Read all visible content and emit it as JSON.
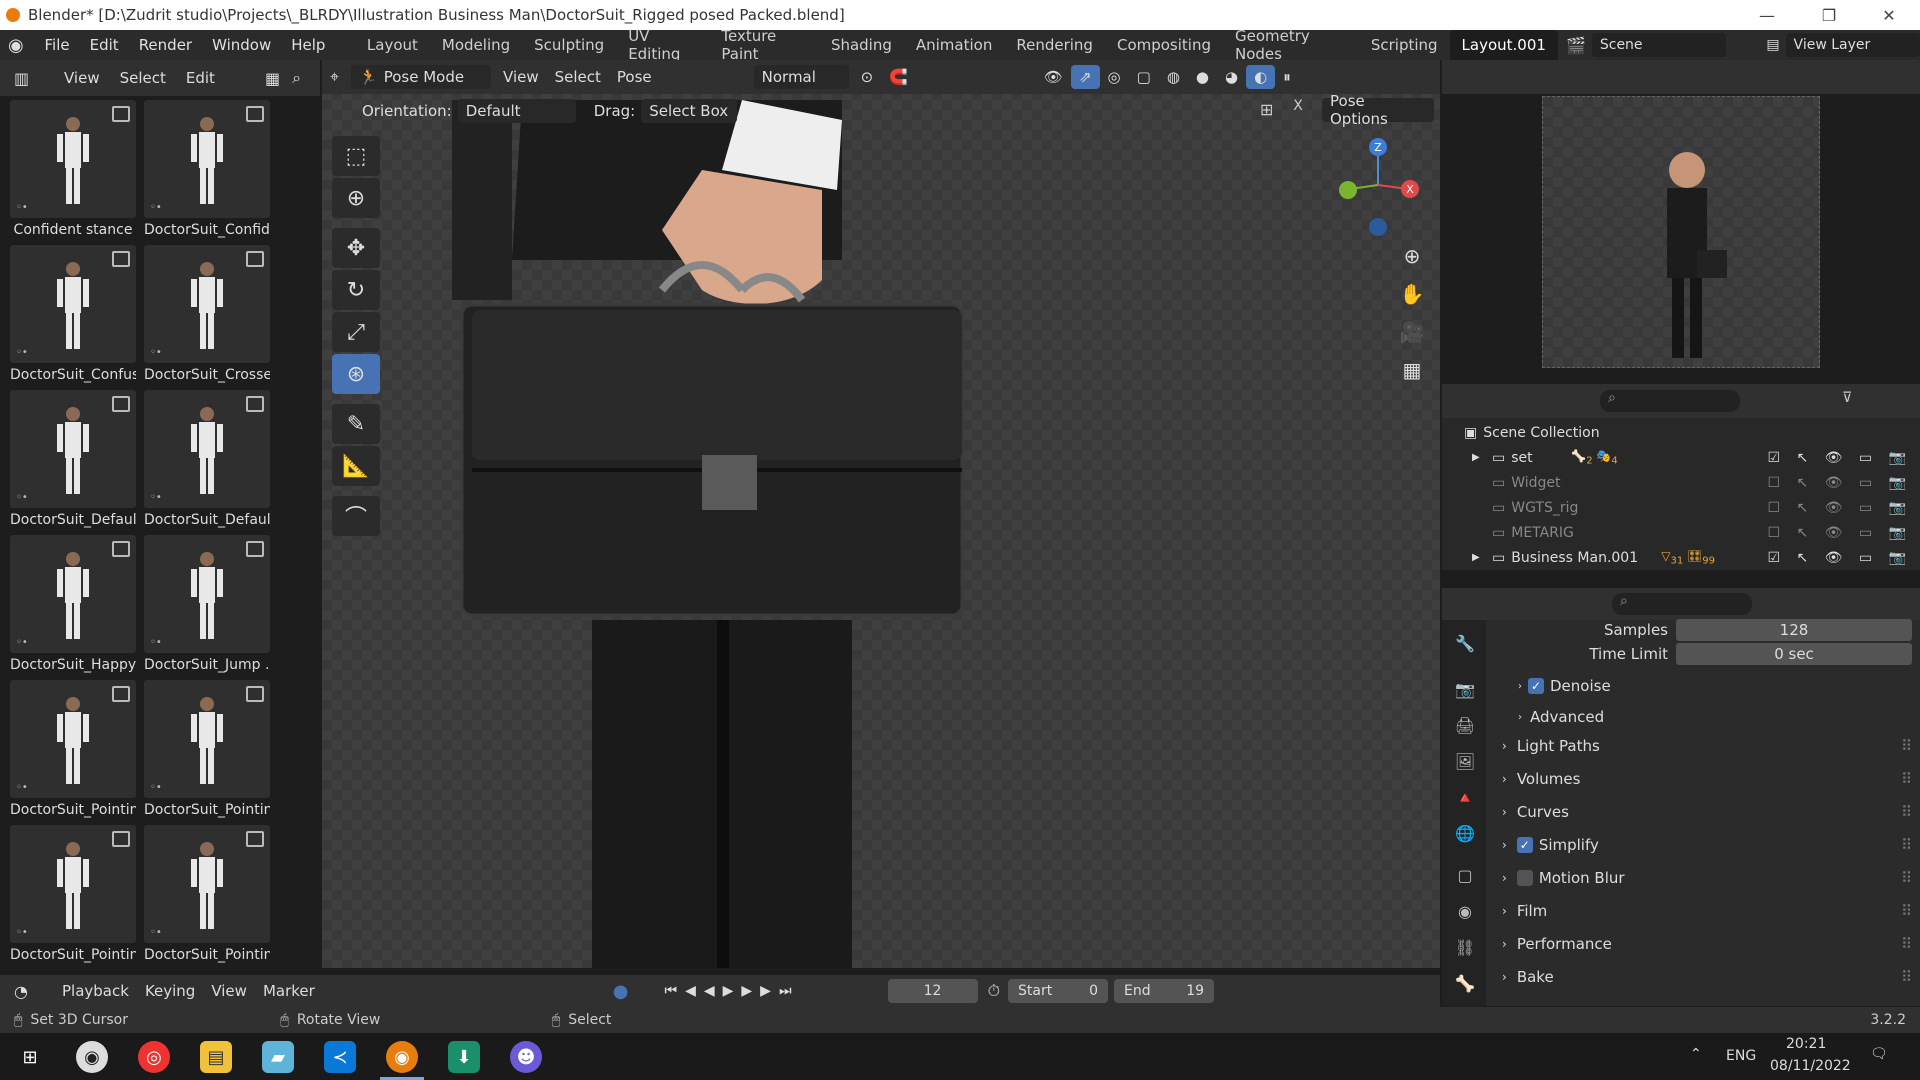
{
  "titlebar": {
    "title": "Blender* [D:\\Zudrit studio\\Projects\\_BLRDY\\Illustration Business Man\\DoctorSuit_Rigged posed Packed.blend]",
    "minimize": "—",
    "maximize": "❐",
    "close": "✕"
  },
  "menu": {
    "items": [
      "File",
      "Edit",
      "Render",
      "Window",
      "Help"
    ]
  },
  "workspaces": [
    "Layout",
    "Modeling",
    "Sculpting",
    "UV Editing",
    "Texture Paint",
    "Shading",
    "Animation",
    "Rendering",
    "Compositing",
    "Geometry Nodes",
    "Scripting",
    "Layout.001"
  ],
  "scene": {
    "label": "Scene",
    "view_layer": "View Layer"
  },
  "asset_panel": {
    "header": [
      "View",
      "Select",
      "Edit"
    ],
    "items": [
      {
        "label": "Confident stance"
      },
      {
        "label": "DoctorSuit_Confid..."
      },
      {
        "label": "DoctorSuit_Confus..."
      },
      {
        "label": "DoctorSuit_Crosse..."
      },
      {
        "label": "DoctorSuit_Defaul..."
      },
      {
        "label": "DoctorSuit_Defaul..."
      },
      {
        "label": "DoctorSuit_Happy"
      },
      {
        "label": "DoctorSuit_Jump ..."
      },
      {
        "label": "DoctorSuit_Pointin..."
      },
      {
        "label": "DoctorSuit_Pointin..."
      },
      {
        "label": "DoctorSuit_Pointin..."
      },
      {
        "label": "DoctorSuit_Pointin..."
      }
    ]
  },
  "viewport": {
    "mode": "Pose Mode",
    "header_menus": [
      "View",
      "Select",
      "Pose"
    ],
    "transform": "Normal",
    "orientation_label": "Orientation:",
    "orientation_value": "Default",
    "drag_label": "Drag:",
    "drag_value": "Select Box",
    "pose_options": "Pose Options",
    "gizmo": {
      "x": "X",
      "y": "Y",
      "z": "Z"
    }
  },
  "timeline": {
    "menus": [
      "Playback",
      "Keying",
      "View",
      "Marker"
    ],
    "current_frame": "12",
    "start_label": "Start",
    "start": "0",
    "end_label": "End",
    "end": "19"
  },
  "statusbar": {
    "left": "Set 3D Cursor",
    "middle": "Rotate View",
    "right": "Select",
    "version": "3.2.2"
  },
  "outliner": {
    "root": "Scene Collection",
    "rows": [
      {
        "name": "set",
        "count1": "2",
        "count2": "4"
      },
      {
        "name": "Widget"
      },
      {
        "name": "WGTS_rig"
      },
      {
        "name": "METARIG"
      },
      {
        "name": "Business Man.001",
        "count1": "31",
        "count2": "99"
      }
    ]
  },
  "properties": {
    "samples_label": "Samples",
    "samples": "128",
    "time_limit_label": "Time Limit",
    "time_limit": "0 sec",
    "denoise": "Denoise",
    "advanced": "Advanced",
    "sections": [
      "Light Paths",
      "Volumes",
      "Curves",
      "Simplify",
      "Motion Blur",
      "Film",
      "Performance",
      "Bake"
    ]
  },
  "taskbar": {
    "lang": "ENG",
    "time": "20:21",
    "date": "08/11/2022"
  },
  "colors": {
    "accent": "#4772b3",
    "bg": "#1d1d1d",
    "blender_orange": "#e87d0d"
  }
}
